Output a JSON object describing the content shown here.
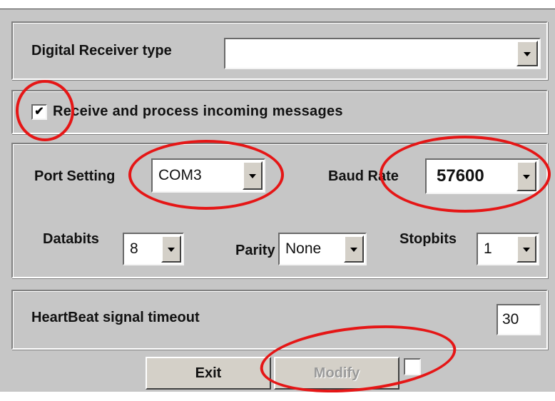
{
  "receiver": {
    "label": "Digital Receiver type",
    "value": ""
  },
  "incoming": {
    "label": "Receive and process incoming messages",
    "checked": true,
    "check_glyph": "✔"
  },
  "port": {
    "label": "Port Setting",
    "value": "COM3"
  },
  "baud": {
    "label": "Baud Rate",
    "value": "57600"
  },
  "databits": {
    "label": "Databits",
    "value": "8"
  },
  "parity": {
    "label": "Parity",
    "value": "None"
  },
  "stopbits": {
    "label": "Stopbits",
    "value": "1"
  },
  "heartbeat": {
    "label": "HeartBeat signal timeout",
    "value": "30"
  },
  "buttons": {
    "exit": "Exit",
    "modify": "Modify"
  },
  "annotations": {
    "color": "#e51616"
  }
}
